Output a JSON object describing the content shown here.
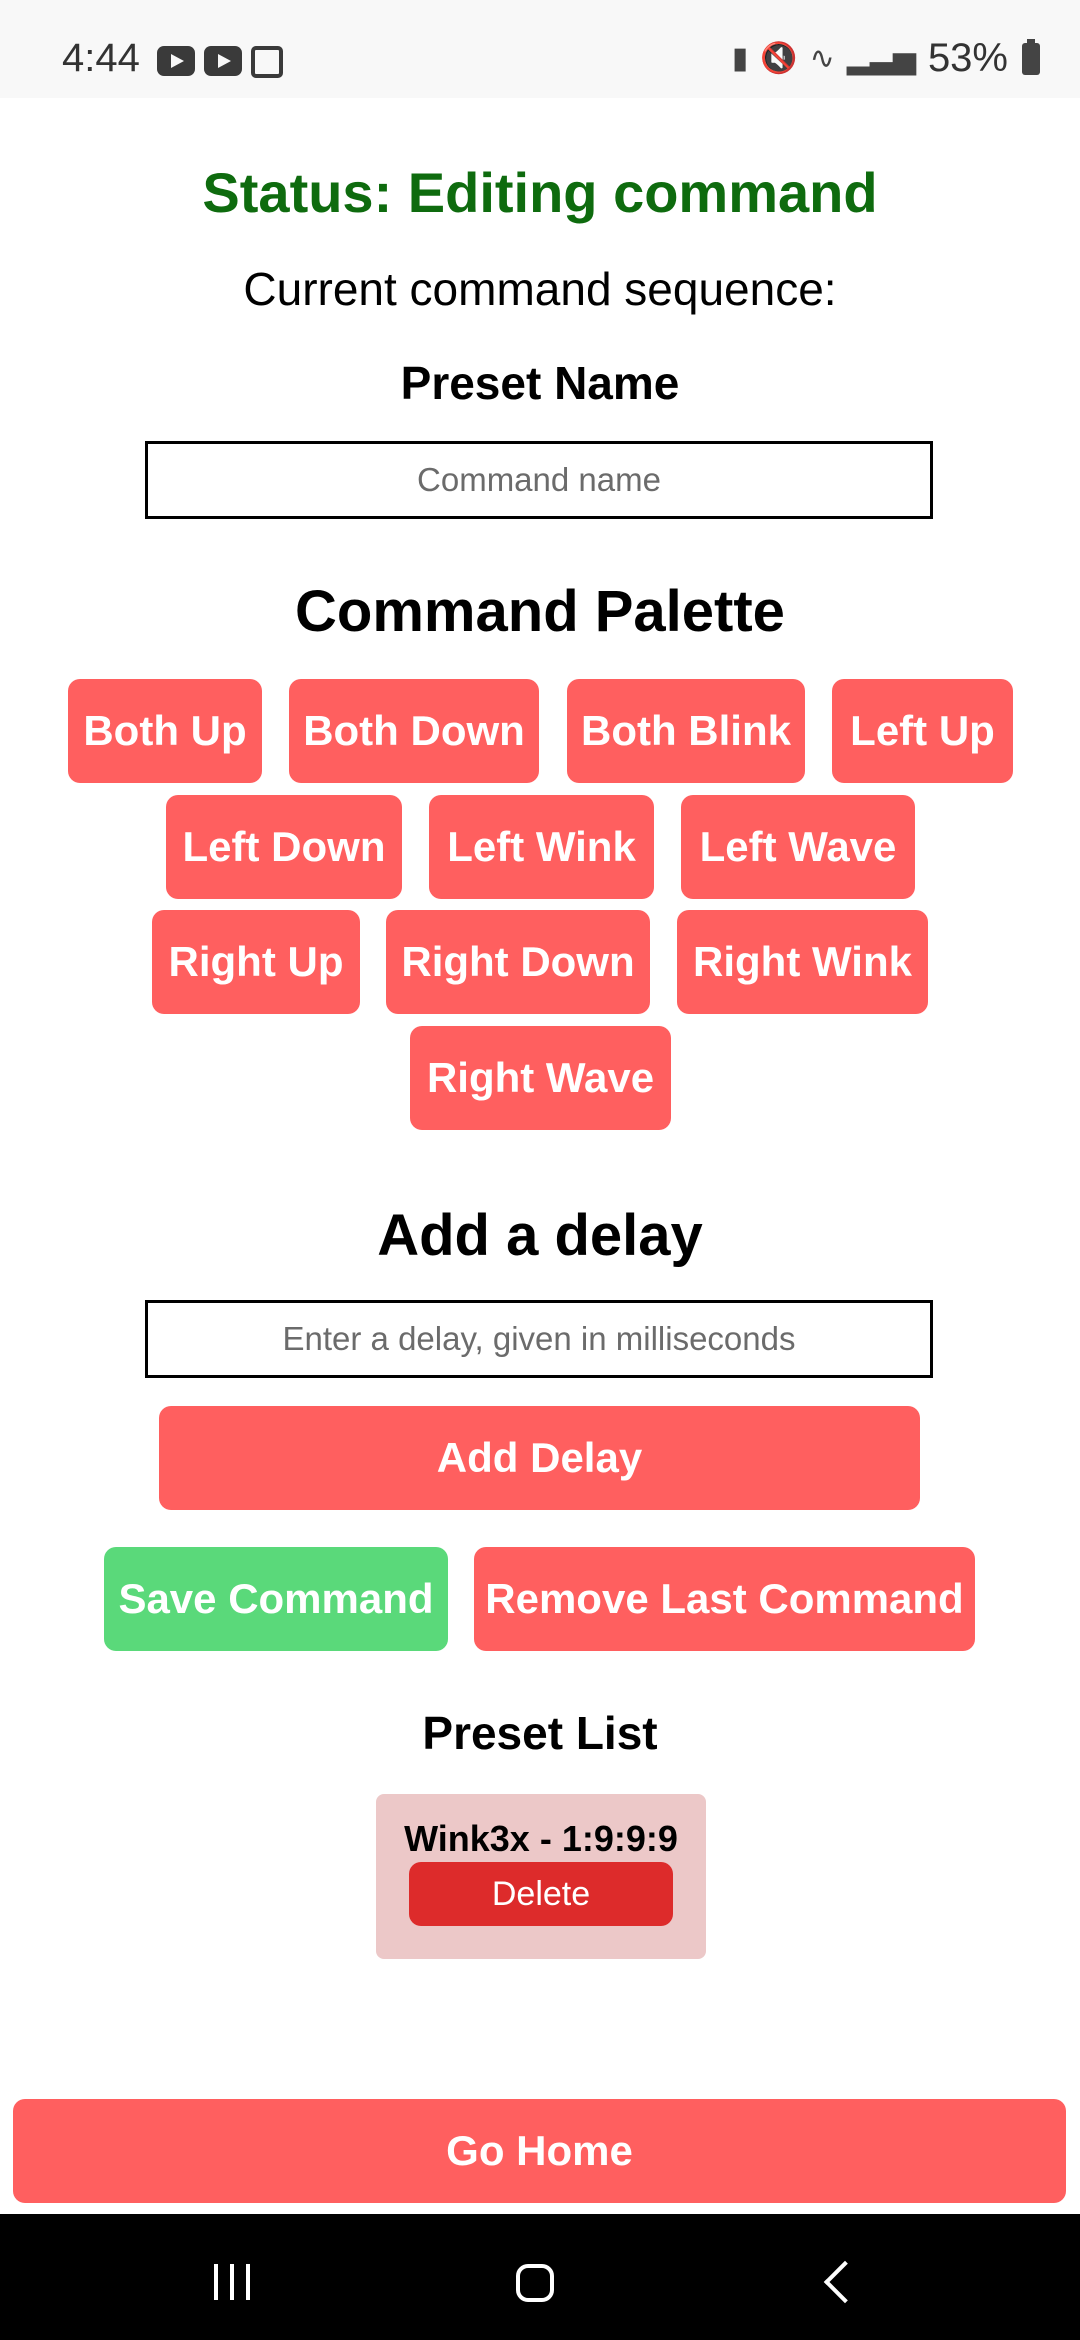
{
  "status_bar": {
    "time": "4:44",
    "left_icons": [
      "youtube-icon",
      "youtube-icon",
      "gallery-icon"
    ],
    "right_icons": [
      "nfc-icon",
      "mute-icon",
      "wifi-icon",
      "signal-icon"
    ],
    "battery": "53%"
  },
  "status": "Status: Editing command",
  "sequence_label": "Current command sequence:",
  "preset_name": {
    "title": "Preset Name",
    "placeholder": "Command name",
    "value": ""
  },
  "palette": {
    "title": "Command Palette",
    "buttons": [
      "Both Up",
      "Both Down",
      "Both Blink",
      "Left Up",
      "Left Down",
      "Left Wink",
      "Left Wave",
      "Right Up",
      "Right Down",
      "Right Wink",
      "Right Wave"
    ]
  },
  "delay": {
    "title": "Add a delay",
    "placeholder": "Enter a delay, given in milliseconds",
    "value": "",
    "add_label": "Add Delay"
  },
  "actions": {
    "save": "Save Command",
    "remove_last": "Remove Last Command"
  },
  "preset_list": {
    "title": "Preset List",
    "items": [
      {
        "text": "Wink3x - 1:9:9:9",
        "delete_label": "Delete"
      }
    ]
  },
  "go_home": "Go Home",
  "colors": {
    "button": "#ff5f5f",
    "save": "#5ad97a",
    "status": "#0e6b0e",
    "preset_card": "#ecc8c8",
    "delete": "#dd2b2b"
  }
}
